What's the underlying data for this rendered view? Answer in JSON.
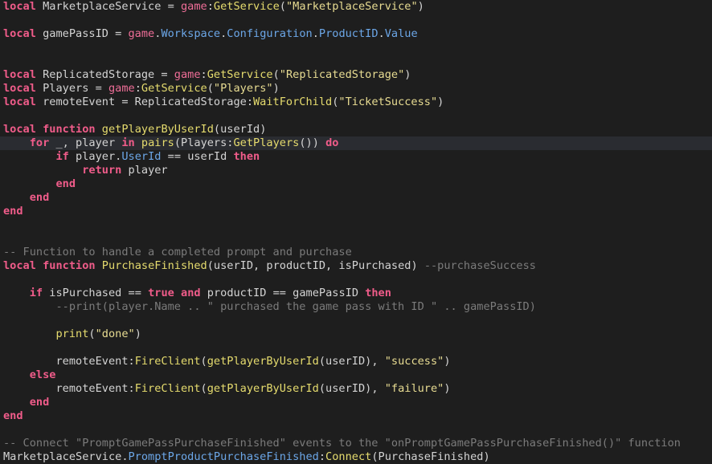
{
  "editor": {
    "lines": [
      {
        "tokens": [
          [
            "kw",
            "local"
          ],
          [
            "pl",
            " MarketplaceService = "
          ],
          [
            "gl",
            "game"
          ],
          [
            "pl",
            ":"
          ],
          [
            "fn",
            "GetService"
          ],
          [
            "pl",
            "("
          ],
          [
            "str",
            "\"MarketplaceService\""
          ],
          [
            "pl",
            ")"
          ]
        ]
      },
      {
        "tokens": []
      },
      {
        "tokens": [
          [
            "kw",
            "local"
          ],
          [
            "pl",
            " gamePassID = "
          ],
          [
            "gl",
            "game"
          ],
          [
            "pl",
            "."
          ],
          [
            "prop",
            "Workspace"
          ],
          [
            "pl",
            "."
          ],
          [
            "prop",
            "Configuration"
          ],
          [
            "pl",
            "."
          ],
          [
            "prop",
            "ProductID"
          ],
          [
            "pl",
            "."
          ],
          [
            "prop",
            "Value"
          ]
        ]
      },
      {
        "tokens": []
      },
      {
        "tokens": []
      },
      {
        "tokens": [
          [
            "kw",
            "local"
          ],
          [
            "pl",
            " ReplicatedStorage = "
          ],
          [
            "gl",
            "game"
          ],
          [
            "pl",
            ":"
          ],
          [
            "fn",
            "GetService"
          ],
          [
            "pl",
            "("
          ],
          [
            "str",
            "\"ReplicatedStorage\""
          ],
          [
            "pl",
            ")"
          ]
        ]
      },
      {
        "tokens": [
          [
            "kw",
            "local"
          ],
          [
            "pl",
            " Players = "
          ],
          [
            "gl",
            "game"
          ],
          [
            "pl",
            ":"
          ],
          [
            "fn",
            "GetService"
          ],
          [
            "pl",
            "("
          ],
          [
            "str",
            "\"Players\""
          ],
          [
            "pl",
            ")"
          ]
        ]
      },
      {
        "tokens": [
          [
            "kw",
            "local"
          ],
          [
            "pl",
            " remoteEvent = ReplicatedStorage:"
          ],
          [
            "fn",
            "WaitForChild"
          ],
          [
            "pl",
            "("
          ],
          [
            "str",
            "\"TicketSuccess\""
          ],
          [
            "pl",
            ")"
          ]
        ]
      },
      {
        "tokens": []
      },
      {
        "tokens": [
          [
            "kw",
            "local"
          ],
          [
            "pl",
            " "
          ],
          [
            "kw",
            "function"
          ],
          [
            "pl",
            " "
          ],
          [
            "fn",
            "getPlayerByUserId"
          ],
          [
            "pl",
            "(userId)"
          ]
        ]
      },
      {
        "highlight": true,
        "tokens": [
          [
            "pl",
            "    "
          ],
          [
            "kw",
            "for"
          ],
          [
            "pl",
            " _, player "
          ],
          [
            "kw",
            "in"
          ],
          [
            "pl",
            " "
          ],
          [
            "fn",
            "pairs"
          ],
          [
            "pl",
            "(Players:"
          ],
          [
            "fn",
            "GetPlayers"
          ],
          [
            "pl",
            "()) "
          ],
          [
            "kw",
            "do"
          ]
        ]
      },
      {
        "tokens": [
          [
            "pl",
            "        "
          ],
          [
            "kw",
            "if"
          ],
          [
            "pl",
            " player."
          ],
          [
            "prop",
            "UserId"
          ],
          [
            "pl",
            " == userId "
          ],
          [
            "kw",
            "then"
          ]
        ]
      },
      {
        "tokens": [
          [
            "pl",
            "            "
          ],
          [
            "kw",
            "return"
          ],
          [
            "pl",
            " player"
          ]
        ]
      },
      {
        "tokens": [
          [
            "pl",
            "        "
          ],
          [
            "kw",
            "end"
          ]
        ]
      },
      {
        "tokens": [
          [
            "pl",
            "    "
          ],
          [
            "kw",
            "end"
          ]
        ]
      },
      {
        "tokens": [
          [
            "kw",
            "end"
          ]
        ]
      },
      {
        "tokens": []
      },
      {
        "tokens": []
      },
      {
        "tokens": [
          [
            "cm",
            "-- Function to handle a completed prompt and purchase"
          ]
        ]
      },
      {
        "tokens": [
          [
            "kw",
            "local"
          ],
          [
            "pl",
            " "
          ],
          [
            "kw",
            "function"
          ],
          [
            "pl",
            " "
          ],
          [
            "fn",
            "PurchaseFinished"
          ],
          [
            "pl",
            "(userID, productID, isPurchased) "
          ],
          [
            "cm",
            "--purchaseSuccess"
          ]
        ]
      },
      {
        "tokens": []
      },
      {
        "tokens": [
          [
            "pl",
            "    "
          ],
          [
            "kw",
            "if"
          ],
          [
            "pl",
            " isPurchased == "
          ],
          [
            "bool",
            "true"
          ],
          [
            "pl",
            " "
          ],
          [
            "kw",
            "and"
          ],
          [
            "pl",
            " productID == gamePassID "
          ],
          [
            "kw",
            "then"
          ]
        ]
      },
      {
        "tokens": [
          [
            "pl",
            "        "
          ],
          [
            "cm",
            "--print(player.Name .. \" purchased the game pass with ID \" .. gamePassID)"
          ]
        ]
      },
      {
        "tokens": []
      },
      {
        "tokens": [
          [
            "pl",
            "        "
          ],
          [
            "fn",
            "print"
          ],
          [
            "pl",
            "("
          ],
          [
            "str",
            "\"done\""
          ],
          [
            "pl",
            ")"
          ]
        ]
      },
      {
        "tokens": []
      },
      {
        "tokens": [
          [
            "pl",
            "        remoteEvent:"
          ],
          [
            "fn",
            "FireClient"
          ],
          [
            "pl",
            "("
          ],
          [
            "fn",
            "getPlayerByUserId"
          ],
          [
            "pl",
            "(userID), "
          ],
          [
            "str",
            "\"success\""
          ],
          [
            "pl",
            ")"
          ]
        ]
      },
      {
        "tokens": [
          [
            "pl",
            "    "
          ],
          [
            "kw",
            "else"
          ]
        ]
      },
      {
        "tokens": [
          [
            "pl",
            "        remoteEvent:"
          ],
          [
            "fn",
            "FireClient"
          ],
          [
            "pl",
            "("
          ],
          [
            "fn",
            "getPlayerByUserId"
          ],
          [
            "pl",
            "(userID), "
          ],
          [
            "str",
            "\"failure\""
          ],
          [
            "pl",
            ")"
          ]
        ]
      },
      {
        "tokens": [
          [
            "pl",
            "    "
          ],
          [
            "kw",
            "end"
          ]
        ]
      },
      {
        "tokens": [
          [
            "kw",
            "end"
          ]
        ]
      },
      {
        "tokens": []
      },
      {
        "tokens": [
          [
            "cm",
            "-- Connect \"PromptGamePassPurchaseFinished\" events to the \"onPromptGamePassPurchaseFinished()\" function"
          ]
        ]
      },
      {
        "tokens": [
          [
            "pl",
            "MarketplaceService."
          ],
          [
            "prop",
            "PromptProductPurchaseFinished"
          ],
          [
            "pl",
            ":"
          ],
          [
            "fn",
            "Connect"
          ],
          [
            "pl",
            "(PurchaseFinished)"
          ]
        ]
      }
    ]
  }
}
